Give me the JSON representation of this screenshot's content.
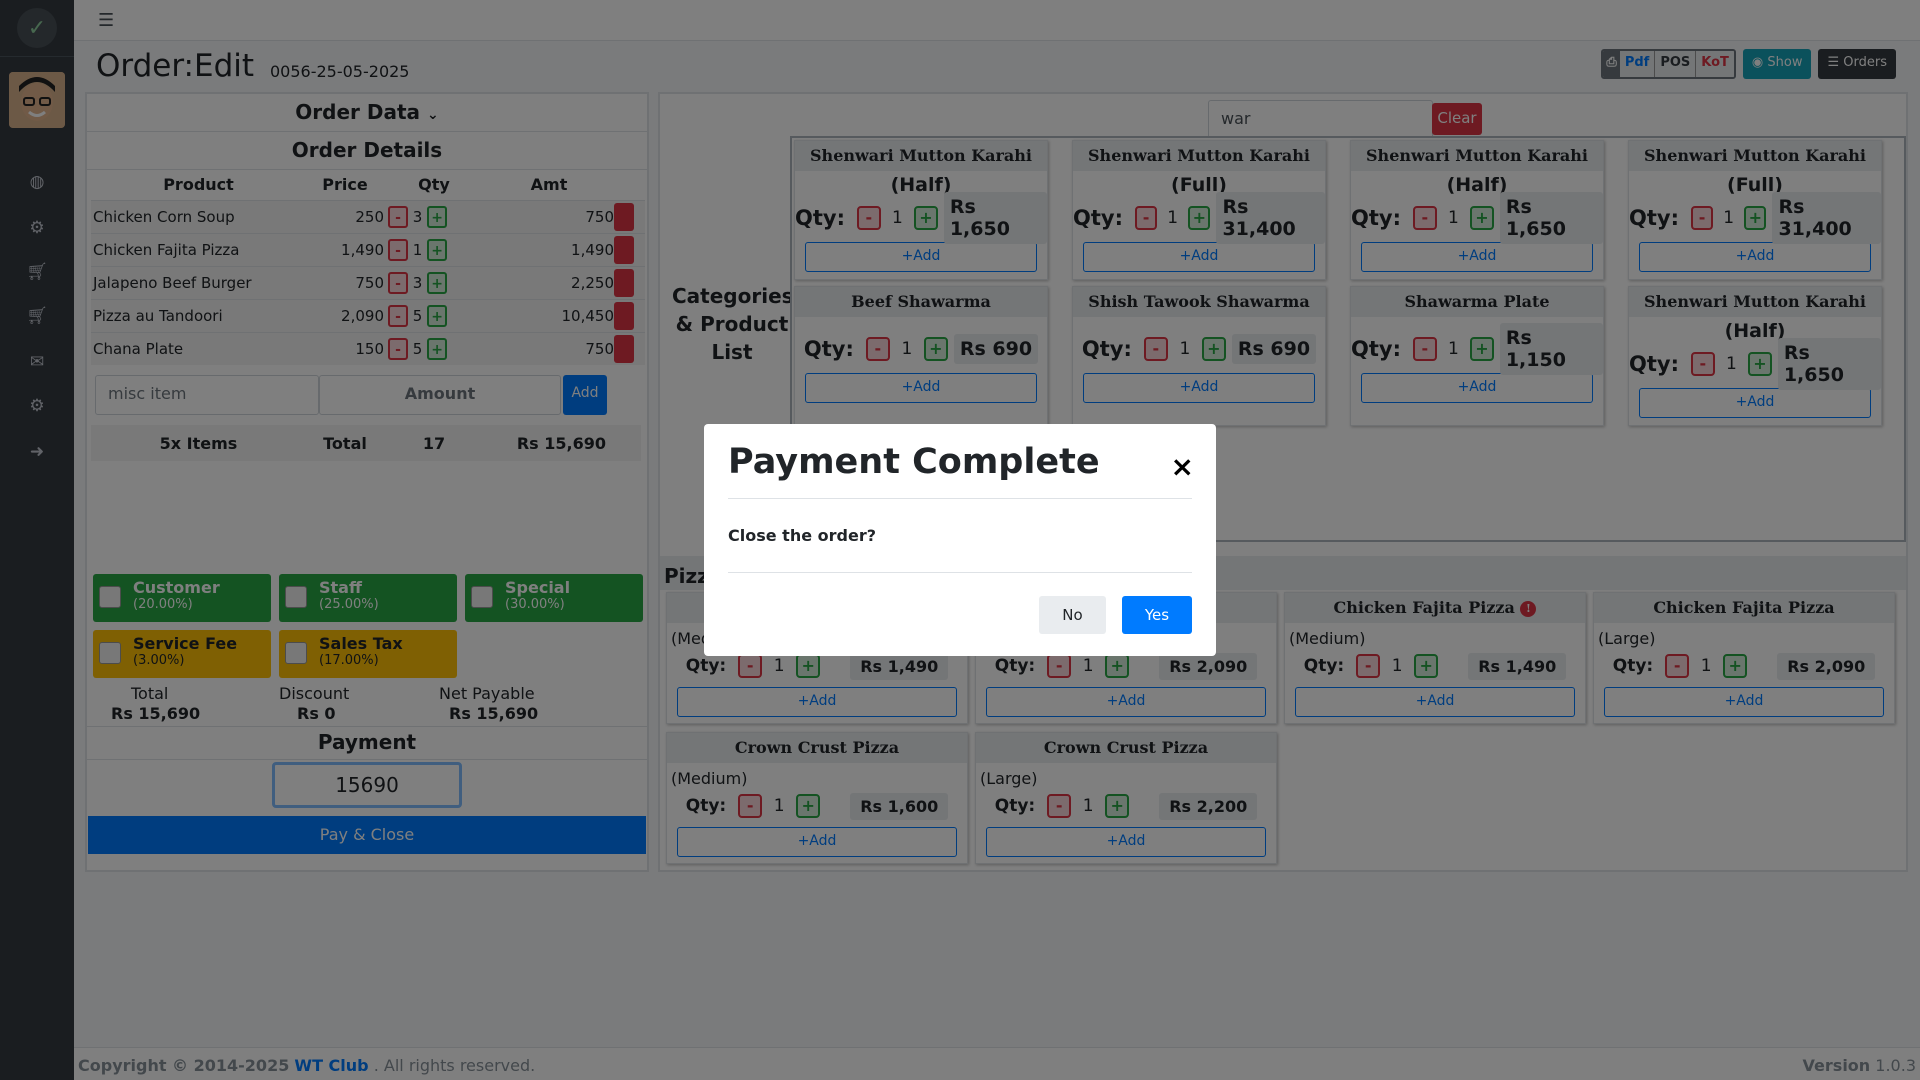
{
  "header": {
    "page_title": "Order:Edit",
    "order_id": "0056-25-05-2025",
    "btn_pdf": "Pdf",
    "btn_pos": "POS",
    "btn_kot": "KoT",
    "btn_show": "Show",
    "btn_orders": "Orders"
  },
  "order": {
    "section_title": "Order Data",
    "details_title": "Order Details",
    "col_product": "Product",
    "col_price": "Price",
    "col_qty": "Qty",
    "col_amt": "Amt",
    "items": [
      {
        "product": "Chicken Corn Soup",
        "price": "250",
        "qty": "3",
        "amt": "750"
      },
      {
        "product": "Chicken Fajita Pizza",
        "price": "1,490",
        "qty": "1",
        "amt": "1,490"
      },
      {
        "product": "Jalapeno Beef Burger",
        "price": "750",
        "qty": "3",
        "amt": "2,250"
      },
      {
        "product": "Pizza au Tandoori",
        "price": "2,090",
        "qty": "5",
        "amt": "10,450"
      },
      {
        "product": "Chana Plate",
        "price": "150",
        "qty": "5",
        "amt": "750"
      }
    ],
    "misc_placeholder": "misc item",
    "amount_placeholder": "Amount",
    "add_label": "Add",
    "items_count": "5x Items",
    "total_label": "Total",
    "total_qty": "17",
    "total_amount": "Rs 15,690"
  },
  "discounts": {
    "customer": {
      "label": "Customer",
      "pct": "(20.00%)"
    },
    "staff": {
      "label": "Staff",
      "pct": "(25.00%)"
    },
    "special": {
      "label": "Special",
      "pct": "(30.00%)"
    },
    "service_fee": {
      "label": "Service Fee",
      "pct": "(3.00%)"
    },
    "sales_tax": {
      "label": "Sales Tax",
      "pct": "(17.00%)"
    }
  },
  "summary": {
    "total_label": "Total",
    "total_value": "Rs 15,690",
    "discount_label": "Discount",
    "discount_value": "Rs 0",
    "net_label": "Net Payable",
    "net_value": "Rs 15,690"
  },
  "payment": {
    "title": "Payment",
    "value": "15690",
    "pay_button": "Pay & Close"
  },
  "products": {
    "categories_label": "Categories & Product List",
    "search_value": "war",
    "clear_label": "Clear",
    "qty_label": "Qty:",
    "add_label": "+Add",
    "cards": [
      {
        "name": "Shenwari Mutton Karahi",
        "variant": "(Half)",
        "qty": "1",
        "price": "Rs 1,650"
      },
      {
        "name": "Shenwari Mutton Karahi",
        "variant": "(Full)",
        "qty": "1",
        "price": "Rs 31,400"
      },
      {
        "name": "Shenwari Mutton Karahi",
        "variant": "(Half)",
        "qty": "1",
        "price": "Rs 1,650"
      },
      {
        "name": "Shenwari Mutton Karahi",
        "variant": "(Full)",
        "qty": "1",
        "price": "Rs 31,400"
      },
      {
        "name": "Beef Shawarma",
        "qty": "1",
        "price": "Rs 690"
      },
      {
        "name": "Shish Tawook Shawarma",
        "qty": "1",
        "price": "Rs 690"
      },
      {
        "name": "Shawarma Plate",
        "qty": "1",
        "price": "Rs 1,150"
      },
      {
        "name": "Shenwari Mutton Karahi",
        "variant": "(Half)",
        "qty": "1",
        "price": "Rs 1,650"
      }
    ],
    "pizza_label": "Pizza",
    "pizza_cards": [
      {
        "name": "",
        "variant": "(Medium)",
        "qty": "1",
        "price": "Rs 1,490"
      },
      {
        "name": "",
        "variant": "",
        "qty": "1",
        "price": "Rs 2,090"
      },
      {
        "name": "Chicken Fajita Pizza",
        "variant": "(Medium)",
        "qty": "1",
        "price": "Rs 1,490",
        "badge": "!"
      },
      {
        "name": "Chicken Fajita Pizza",
        "variant": "(Large)",
        "qty": "1",
        "price": "Rs 2,090"
      },
      {
        "name": "Crown Crust Pizza",
        "variant": "(Medium)",
        "qty": "1",
        "price": "Rs 1,600"
      },
      {
        "name": "Crown Crust Pizza",
        "variant": "(Large)",
        "qty": "1",
        "price": "Rs 2,200"
      }
    ]
  },
  "modal": {
    "title": "Payment Complete",
    "close": "×",
    "body": "Close the order?",
    "no": "No",
    "yes": "Yes"
  },
  "footer": {
    "copyright": "Copyright © 2014-2025",
    "company": "WT Club",
    "rights": ". All rights reserved.",
    "version_label": "Version",
    "version": "1.0.3"
  },
  "colors": {
    "primary": "#007bff",
    "danger": "#dc3545",
    "success": "#28a745",
    "warning": "#ffc107",
    "sidebar": "#343a40"
  }
}
